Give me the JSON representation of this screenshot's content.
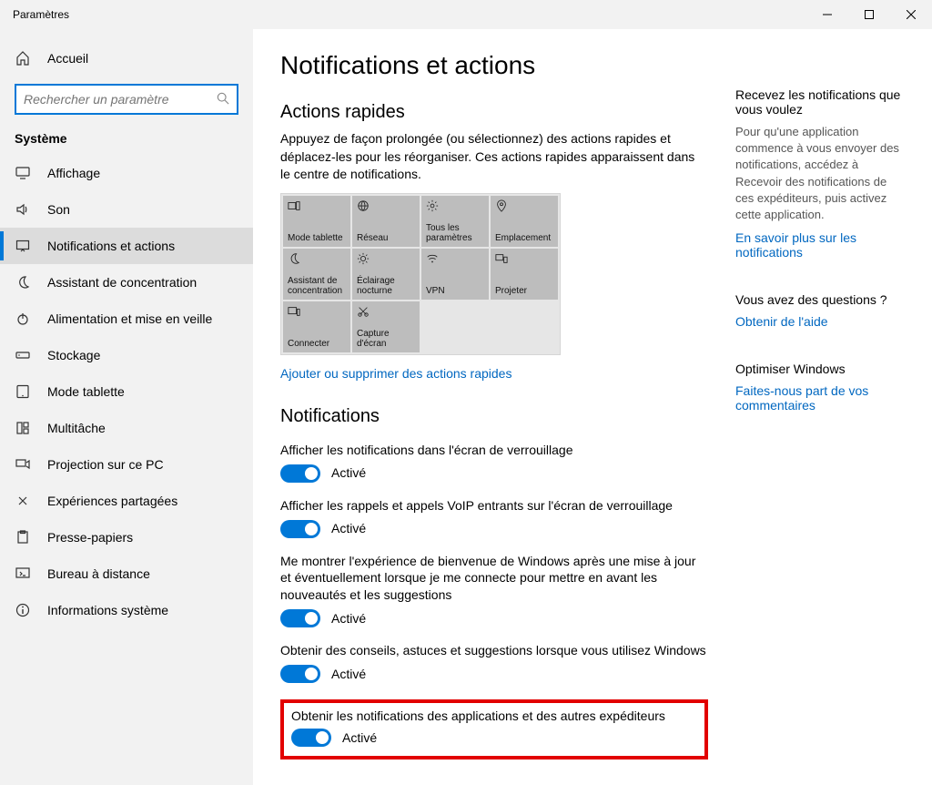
{
  "window": {
    "title": "Paramètres"
  },
  "sidebar": {
    "home": "Accueil",
    "search_placeholder": "Rechercher un paramètre",
    "heading": "Système",
    "items": [
      {
        "icon": "display",
        "label": "Affichage"
      },
      {
        "icon": "sound",
        "label": "Son"
      },
      {
        "icon": "notify",
        "label": "Notifications et actions",
        "active": true
      },
      {
        "icon": "moon",
        "label": "Assistant de concentration"
      },
      {
        "icon": "power",
        "label": "Alimentation et mise en veille"
      },
      {
        "icon": "storage",
        "label": "Stockage"
      },
      {
        "icon": "tablet",
        "label": "Mode tablette"
      },
      {
        "icon": "multitask",
        "label": "Multitâche"
      },
      {
        "icon": "projection",
        "label": "Projection sur ce PC"
      },
      {
        "icon": "share",
        "label": "Expériences partagées"
      },
      {
        "icon": "clipboard",
        "label": "Presse-papiers"
      },
      {
        "icon": "remote",
        "label": "Bureau à distance"
      },
      {
        "icon": "info",
        "label": "Informations système"
      }
    ]
  },
  "main": {
    "title": "Notifications et actions",
    "quick_actions": {
      "heading": "Actions rapides",
      "description": "Appuyez de façon prolongée (ou sélectionnez) des actions rapides et déplacez-les pour les réorganiser. Ces actions rapides apparaissent dans le centre de notifications.",
      "tiles": [
        {
          "icon": "tablet-mode",
          "label": "Mode tablette"
        },
        {
          "icon": "network",
          "label": "Réseau"
        },
        {
          "icon": "gear",
          "label": "Tous les paramètres"
        },
        {
          "icon": "location",
          "label": "Emplacement"
        },
        {
          "icon": "moon",
          "label": "Assistant de concentration"
        },
        {
          "icon": "night",
          "label": "Éclairage nocturne"
        },
        {
          "icon": "vpn",
          "label": "VPN"
        },
        {
          "icon": "project",
          "label": "Projeter"
        },
        {
          "icon": "connect",
          "label": "Connecter"
        },
        {
          "icon": "snip",
          "label": "Capture d'écran"
        }
      ],
      "edit_link": "Ajouter ou supprimer des actions rapides"
    },
    "notifications": {
      "heading": "Notifications",
      "on_label": "Activé",
      "items": [
        {
          "text": "Afficher les notifications dans l'écran de verrouillage",
          "state": true
        },
        {
          "text": "Afficher les rappels et appels VoIP entrants sur l'écran de verrouillage",
          "state": true
        },
        {
          "text": "Me montrer l'expérience de bienvenue de Windows après une mise à jour et éventuellement lorsque je me connecte pour mettre en avant les nouveautés et les suggestions",
          "state": true
        },
        {
          "text": "Obtenir des conseils, astuces et suggestions lorsque vous utilisez Windows",
          "state": true
        },
        {
          "text": "Obtenir les notifications des applications et des autres expéditeurs",
          "state": true,
          "highlighted": true
        }
      ]
    }
  },
  "right": {
    "notif_title": "Recevez les notifications que vous voulez",
    "notif_text": "Pour qu'une application commence à vous envoyer des notifications, accédez à Recevoir des notifications de ces expéditeurs, puis activez cette application.",
    "notif_link": "En savoir plus sur les notifications",
    "help_title": "Vous avez des questions ?",
    "help_link": "Obtenir de l'aide",
    "improve_title": "Optimiser Windows",
    "improve_link": "Faites-nous part de vos commentaires"
  }
}
